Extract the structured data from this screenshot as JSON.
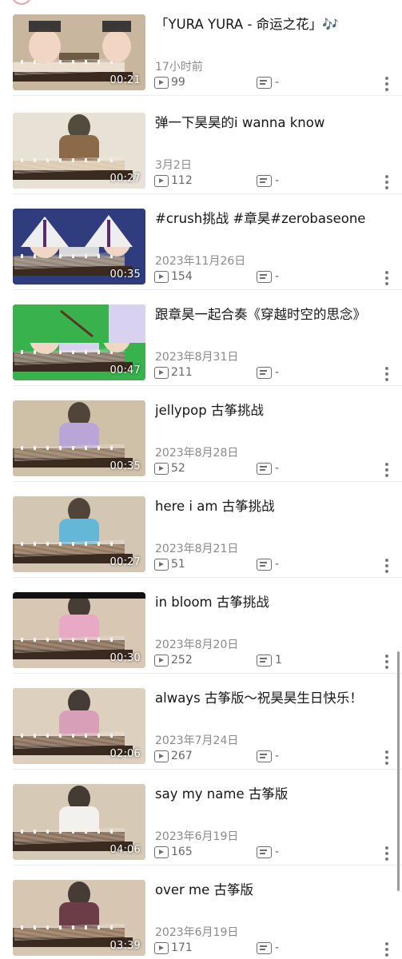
{
  "videos": [
    {
      "title": "「YURA YURA - 命运之花」🎶",
      "duration": "00:21",
      "date": "17小时前",
      "views": "99",
      "comments": "-"
    },
    {
      "title": "弹一下昊昊的i wanna know",
      "duration": "00:27",
      "date": "3月2日",
      "views": "112",
      "comments": "-"
    },
    {
      "title": "#crush挑战 #章昊#zerobaseone",
      "duration": "00:35",
      "date": "2023年11月26日",
      "views": "154",
      "comments": "-"
    },
    {
      "title": "跟章昊一起合奏《穿越时空的思念》",
      "duration": "00:47",
      "date": "2023年8月31日",
      "views": "211",
      "comments": "-"
    },
    {
      "title": "jellypop 古筝挑战",
      "duration": "00:35",
      "date": "2023年8月28日",
      "views": "52",
      "comments": "-"
    },
    {
      "title": "here i am 古筝挑战",
      "duration": "00:27",
      "date": "2023年8月21日",
      "views": "51",
      "comments": "-"
    },
    {
      "title": "in bloom 古筝挑战",
      "duration": "00:30",
      "date": "2023年8月20日",
      "views": "252",
      "comments": "1"
    },
    {
      "title": "always 古筝版～祝昊昊生日快乐！",
      "duration": "02:06",
      "date": "2023年7月24日",
      "views": "267",
      "comments": "-"
    },
    {
      "title": "say my name 古筝版",
      "duration": "04:06",
      "date": "2023年6月19日",
      "views": "165",
      "comments": "-"
    },
    {
      "title": "over me 古筝版",
      "duration": "03:39",
      "date": "2023年6月19日",
      "views": "171",
      "comments": "-"
    }
  ]
}
